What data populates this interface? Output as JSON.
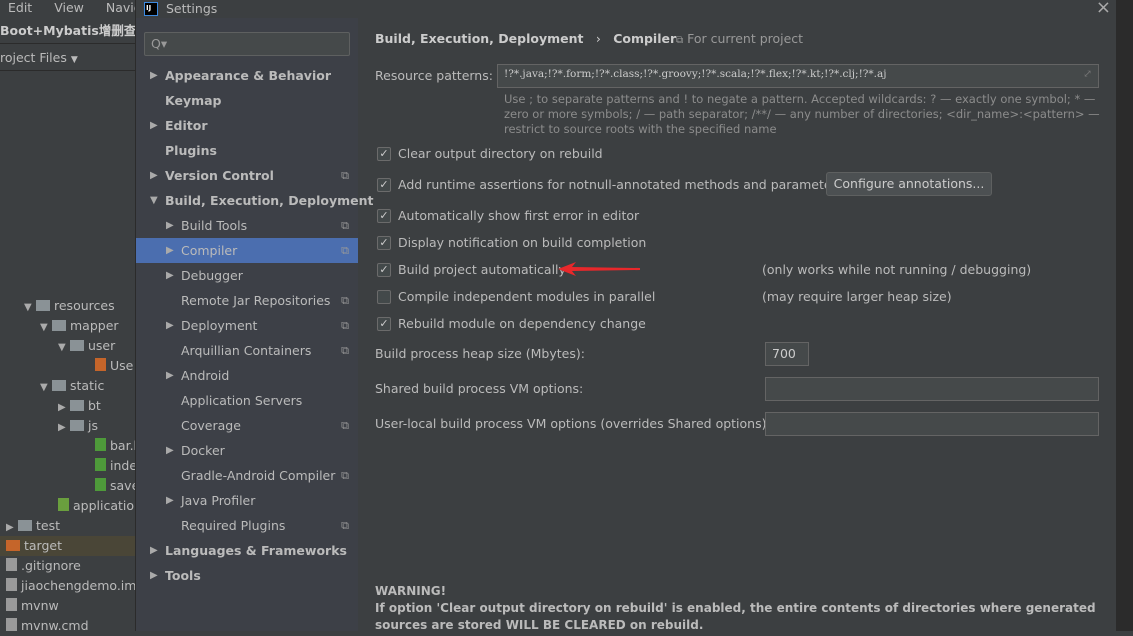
{
  "ide": {
    "menu": [
      "Edit",
      "View",
      "Navigate"
    ],
    "project_title": "Boot+Mybatis增删查改",
    "project_view": "roject Files",
    "tree": [
      {
        "label": "resources",
        "indent": 1,
        "arrow": "▼",
        "icon": "folder"
      },
      {
        "label": "mapper",
        "indent": 2,
        "arrow": "▼",
        "icon": "folder"
      },
      {
        "label": "user",
        "indent": 3,
        "arrow": "▼",
        "icon": "folder"
      },
      {
        "label": "Use",
        "indent": 4,
        "arrow": "",
        "icon": "xml-file"
      },
      {
        "label": "static",
        "indent": 2,
        "arrow": "▼",
        "icon": "folder"
      },
      {
        "label": "bt",
        "indent": 3,
        "arrow": "▶",
        "icon": "folder"
      },
      {
        "label": "js",
        "indent": 3,
        "arrow": "▶",
        "icon": "folder"
      },
      {
        "label": "bar.htm",
        "indent": 4,
        "arrow": "",
        "icon": "html-file"
      },
      {
        "label": "index.h",
        "indent": 4,
        "arrow": "",
        "icon": "html-file"
      },
      {
        "label": "save.ht",
        "indent": 4,
        "arrow": "",
        "icon": "html-file"
      },
      {
        "label": "applicatio",
        "indent": 3,
        "arrow": "",
        "icon": "spring-config"
      },
      {
        "label": "test",
        "indent": 0,
        "arrow": "▶",
        "icon": "folder"
      },
      {
        "label": "target",
        "indent": 0,
        "arrow": "",
        "icon": "folder-excluded"
      },
      {
        "label": ".gitignore",
        "indent": 0,
        "arrow": "",
        "icon": "file"
      },
      {
        "label": "jiaochengdemo.iml",
        "indent": 0,
        "arrow": "",
        "icon": "file"
      },
      {
        "label": "mvnw",
        "indent": 0,
        "arrow": "",
        "icon": "file"
      },
      {
        "label": "mvnw.cmd",
        "indent": 0,
        "arrow": "",
        "icon": "file"
      }
    ]
  },
  "dialog": {
    "title": "Settings",
    "search_placeholder": "Q▾",
    "nav": [
      {
        "label": "Appearance & Behavior",
        "level": 0,
        "arrow": "▶",
        "copy": false
      },
      {
        "label": "Keymap",
        "level": 0,
        "arrow": "",
        "copy": false
      },
      {
        "label": "Editor",
        "level": 0,
        "arrow": "▶",
        "copy": false
      },
      {
        "label": "Plugins",
        "level": 0,
        "arrow": "",
        "copy": false
      },
      {
        "label": "Version Control",
        "level": 0,
        "arrow": "▶",
        "copy": true
      },
      {
        "label": "Build, Execution, Deployment",
        "level": 0,
        "arrow": "▼",
        "copy": false
      },
      {
        "label": "Build Tools",
        "level": 1,
        "arrow": "▶",
        "copy": true
      },
      {
        "label": "Compiler",
        "level": 1,
        "arrow": "▶",
        "copy": true,
        "selected": true
      },
      {
        "label": "Debugger",
        "level": 1,
        "arrow": "▶",
        "copy": false
      },
      {
        "label": "Remote Jar Repositories",
        "level": 1,
        "arrow": "",
        "copy": true
      },
      {
        "label": "Deployment",
        "level": 1,
        "arrow": "▶",
        "copy": true
      },
      {
        "label": "Arquillian Containers",
        "level": 1,
        "arrow": "",
        "copy": true
      },
      {
        "label": "Android",
        "level": 1,
        "arrow": "▶",
        "copy": false
      },
      {
        "label": "Application Servers",
        "level": 1,
        "arrow": "",
        "copy": false
      },
      {
        "label": "Coverage",
        "level": 1,
        "arrow": "",
        "copy": true
      },
      {
        "label": "Docker",
        "level": 1,
        "arrow": "▶",
        "copy": false
      },
      {
        "label": "Gradle-Android Compiler",
        "level": 1,
        "arrow": "",
        "copy": true
      },
      {
        "label": "Java Profiler",
        "level": 1,
        "arrow": "▶",
        "copy": false
      },
      {
        "label": "Required Plugins",
        "level": 1,
        "arrow": "",
        "copy": true
      },
      {
        "label": "Languages & Frameworks",
        "level": 0,
        "arrow": "▶",
        "copy": false
      },
      {
        "label": "Tools",
        "level": 0,
        "arrow": "▶",
        "copy": false
      }
    ],
    "breadcrumb": {
      "parent": "Build, Execution, Deployment",
      "sep": "›",
      "current": "Compiler",
      "scope": "For current project"
    },
    "resource_patterns": {
      "label": "Resource patterns:",
      "value": "!?*.java;!?*.form;!?*.class;!?*.groovy;!?*.scala;!?*.flex;!?*.kt;!?*.clj;!?*.aj",
      "hint": "Use ; to separate patterns and ! to negate a pattern. Accepted wildcards: ? — exactly one symbol; * — zero or more symbols; / — path separator; /**/ — any number of directories; <dir_name>:<pattern> — restrict to source roots with the specified name"
    },
    "options": [
      {
        "label": "Clear output directory on rebuild",
        "checked": true,
        "note": ""
      },
      {
        "label": "Add runtime assertions for notnull-annotated methods and parameters",
        "checked": true,
        "note": ""
      },
      {
        "label": "Automatically show first error in editor",
        "checked": true,
        "note": ""
      },
      {
        "label": "Display notification on build completion",
        "checked": true,
        "note": ""
      },
      {
        "label": "Build project automatically",
        "checked": true,
        "note": "(only works while not running / debugging)"
      },
      {
        "label": "Compile independent modules in parallel",
        "checked": false,
        "note": "(may require larger heap size)"
      },
      {
        "label": "Rebuild module on dependency change",
        "checked": true,
        "note": ""
      }
    ],
    "configure_annotations": "Configure annotations...",
    "heap": {
      "label": "Build process heap size (Mbytes):",
      "value": "700"
    },
    "shared_vm": {
      "label": "Shared build process VM options:",
      "value": ""
    },
    "user_vm": {
      "label": "User-local build process VM options (overrides Shared options):",
      "value": ""
    },
    "warning": {
      "title": "WARNING!",
      "text": "If option 'Clear output directory on rebuild' is enabled, the entire contents of directories where generated sources are stored WILL BE CLEARED on rebuild."
    },
    "arrow_color": "#e8282b",
    "selection_color": "#4b6eaf"
  }
}
